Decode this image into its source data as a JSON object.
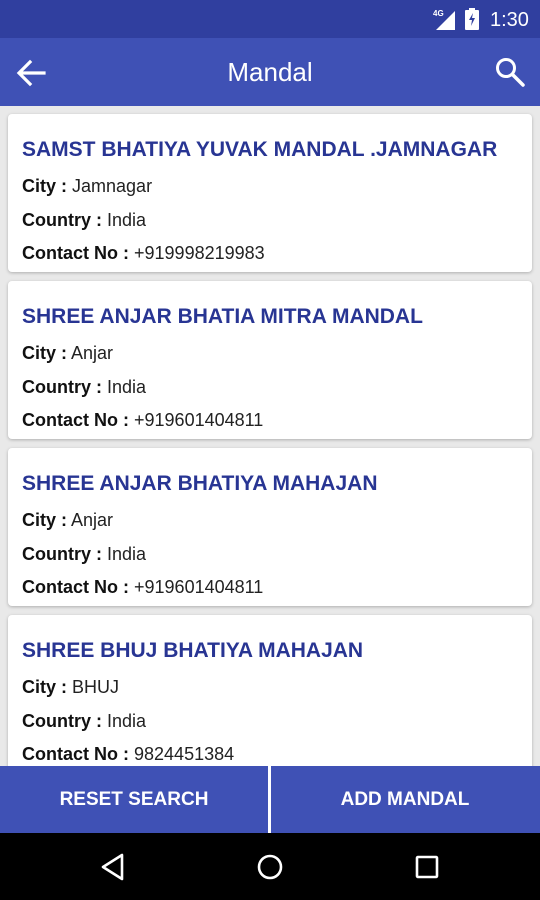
{
  "status_bar": {
    "network_label": "4G",
    "network_icon": "signal-icon",
    "battery_icon": "battery-icon",
    "time": "1:30"
  },
  "app_bar": {
    "title": "Mandal",
    "back_icon": "arrow-back-icon",
    "search_icon": "search-icon"
  },
  "labels": {
    "city": "City :",
    "country": "Country :",
    "contact": "Contact No :"
  },
  "mandals": [
    {
      "name": "SAMST BHATIYA YUVAK MANDAL .JAMNAGAR",
      "city": "Jamnagar",
      "country": "India",
      "contact": "+919998219983"
    },
    {
      "name": "SHREE ANJAR BHATIA MITRA MANDAL",
      "city": "Anjar",
      "country": "India",
      "contact": "+919601404811"
    },
    {
      "name": "SHREE ANJAR BHATIYA MAHAJAN",
      "city": "Anjar",
      "country": "India",
      "contact": "+919601404811"
    },
    {
      "name": "SHREE BHUJ BHATIYA MAHAJAN",
      "city": "BHUJ",
      "country": "India",
      "contact": "9824451384"
    }
  ],
  "bottom_bar": {
    "reset_label": "RESET SEARCH",
    "add_label": "ADD MANDAL"
  },
  "nav_bar": {
    "back_icon": "nav-back-icon",
    "home_icon": "nav-home-icon",
    "recents_icon": "nav-recents-icon"
  },
  "colors": {
    "status_bar": "#303f9f",
    "primary": "#3f51b5",
    "card_title": "#283593",
    "background": "#e9e9e9"
  }
}
